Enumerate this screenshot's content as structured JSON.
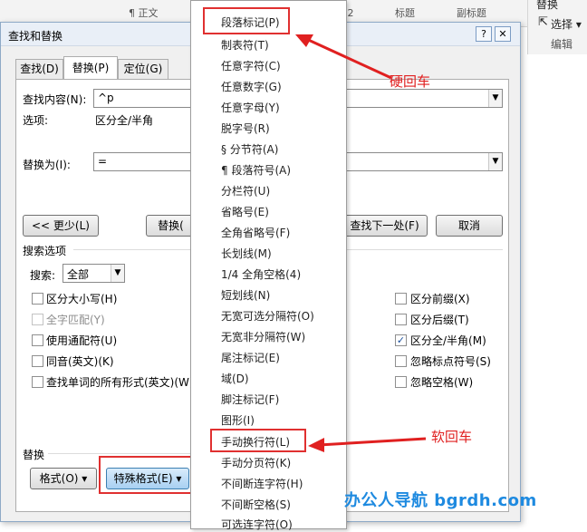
{
  "ribbon": {
    "gallery": [
      "¶ 正文",
      "标题 2",
      "标题",
      "副标题"
    ],
    "right": {
      "replace": "替换",
      "select": "选择 ▾",
      "group": "编辑"
    }
  },
  "dialog": {
    "title": "查找和替换",
    "help": "?",
    "close": "✕",
    "tabs": [
      "查找(D)",
      "替换(P)",
      "定位(G)"
    ],
    "find_label": "查找内容(N):",
    "find_value": "^p",
    "options_label": "选项:",
    "options_value": "区分全/半角",
    "replace_label": "替换为(I):",
    "replace_value": "=",
    "buttons": {
      "less": "<< 更少(L)",
      "replace": "替换(",
      "find_next": "查找下一处(F)",
      "cancel": "取消"
    },
    "search_options": "搜索选项",
    "search_label": "搜索:",
    "search_value": "全部",
    "left_checks": [
      "区分大小写(H)",
      "全字匹配(Y)",
      "使用通配符(U)",
      "同音(英文)(K)",
      "查找单词的所有形式(英文)(W)"
    ],
    "left_checked": [
      false,
      false,
      false,
      false,
      false
    ],
    "right_checks": [
      "区分前缀(X)",
      "区分后缀(T)",
      "区分全/半角(M)",
      "忽略标点符号(S)",
      "忽略空格(W)"
    ],
    "right_checked": [
      false,
      false,
      true,
      false,
      false
    ],
    "replace_section": "替换",
    "format_button": "格式(O) ▾",
    "special_button": "特殊格式(E) ▾"
  },
  "menu": {
    "items": [
      "段落标记(P)",
      "制表符(T)",
      "任意字符(C)",
      "任意数字(G)",
      "任意字母(Y)",
      "脱字号(R)",
      "§ 分节符(A)",
      "¶ 段落符号(A)",
      "分栏符(U)",
      "省略号(E)",
      "全角省略号(F)",
      "长划线(M)",
      "1/4 全角空格(4)",
      "短划线(N)",
      "无宽可选分隔符(O)",
      "无宽非分隔符(W)",
      "尾注标记(E)",
      "域(D)",
      "脚注标记(F)",
      "图形(I)",
      "手动换行符(L)",
      "手动分页符(K)",
      "不间断连字符(H)",
      "不间断空格(S)",
      "可选连字符(O)"
    ]
  },
  "annotations": {
    "hard_return": "硬回车",
    "soft_return": "软回车",
    "red": "#e02020"
  },
  "watermark": "办公人导航 bgrdh.com"
}
